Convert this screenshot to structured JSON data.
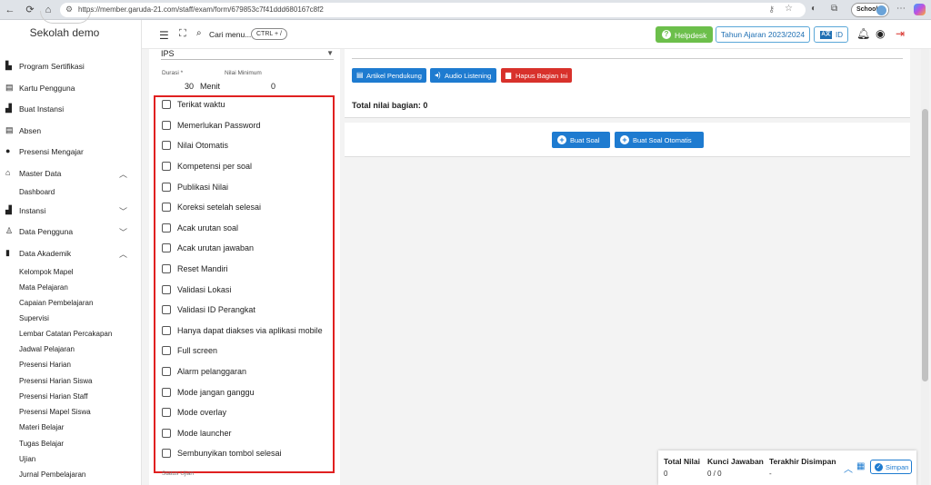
{
  "browser": {
    "url": "https://member.garuda-21.com/staff/exam/form/679853c7f41ddd680167c8f2",
    "profile_label": "School"
  },
  "sidebar": {
    "school_name": "Sekolah demo",
    "items": [
      {
        "label": "Program Sertifikasi",
        "icon": "certificate-icon"
      },
      {
        "label": "Kartu Pengguna",
        "icon": "id-card-icon"
      },
      {
        "label": "Buat Instansi",
        "icon": "building-icon"
      },
      {
        "label": "Absen",
        "icon": "attendance-card-icon"
      },
      {
        "label": "Presensi Mengajar",
        "icon": "check-circle-icon"
      },
      {
        "label": "Master Data",
        "icon": "home-icon"
      },
      {
        "label": "Instansi",
        "icon": "building-icon"
      },
      {
        "label": "Data Pengguna",
        "icon": "user-icon"
      },
      {
        "label": "Data Akademik",
        "icon": "book-icon"
      }
    ],
    "master_sub": [
      "Dashboard"
    ],
    "akademik_sub": [
      "Kelompok Mapel",
      "Mata Pelajaran",
      "Capaian Pembelajaran",
      "Supervisi",
      "Lembar Catatan Percakapan",
      "Jadwal Pelajaran",
      "Presensi Harian",
      "Presensi Harian Siswa",
      "Presensi Harian Staff",
      "Presensi Mapel Siswa",
      "Materi Belajar",
      "Tugas Belajar",
      "Ujian",
      "Jurnal Pembelajaran"
    ]
  },
  "appbar": {
    "search_label": "Cari menu...",
    "shortcut": "CTRL + /",
    "helpdesk_label": "Helpdesk",
    "year_label": "Tahun Ajaran 2023/2024",
    "lang_flag": "A文",
    "lang_label": "ID"
  },
  "form": {
    "subject_value": "IPS",
    "durasi_label": "Durasi *",
    "durasi_value": "30",
    "durasi_unit": "Menit",
    "nilai_min_label": "Nilai Minimum",
    "nilai_min_value": "0",
    "options": [
      "Terikat waktu",
      "Memerlukan Password",
      "Nilai Otomatis",
      "Kompetensi per soal",
      "Publikasi Nilai",
      "Koreksi setelah selesai",
      "Acak urutan soal",
      "Acak urutan jawaban",
      "Reset Mandiri",
      "Validasi Lokasi",
      "Validasi ID Perangkat",
      "Hanya dapat diakses via aplikasi mobile",
      "Full screen",
      "Alarm pelanggaran",
      "Mode jangan ganggu",
      "Mode overlay",
      "Mode launcher",
      "Sembunyikan tombol selesai"
    ],
    "status_label": "Status Ujian"
  },
  "section": {
    "artikel_label": "Artikel Pendukung",
    "audio_label": "Audio Listening",
    "hapus_label": "Hapus Bagian Ini",
    "total_label": "Total nilai bagian: 0",
    "buat_soal_label": "Buat Soal",
    "buat_otomatis_label": "Buat Soal Otomatis"
  },
  "summary": {
    "total_nilai_label": "Total Nilai",
    "total_nilai_value": "0",
    "kunci_label": "Kunci Jawaban",
    "kunci_value": "0 / 0",
    "terakhir_label": "Terakhir Disimpan",
    "terakhir_value": "-",
    "save_label": "Simpan"
  },
  "colors": {
    "green": "#6cbf4b",
    "blue": "#1e7bd0",
    "red": "#d8312b",
    "highlight": "#e02020"
  }
}
